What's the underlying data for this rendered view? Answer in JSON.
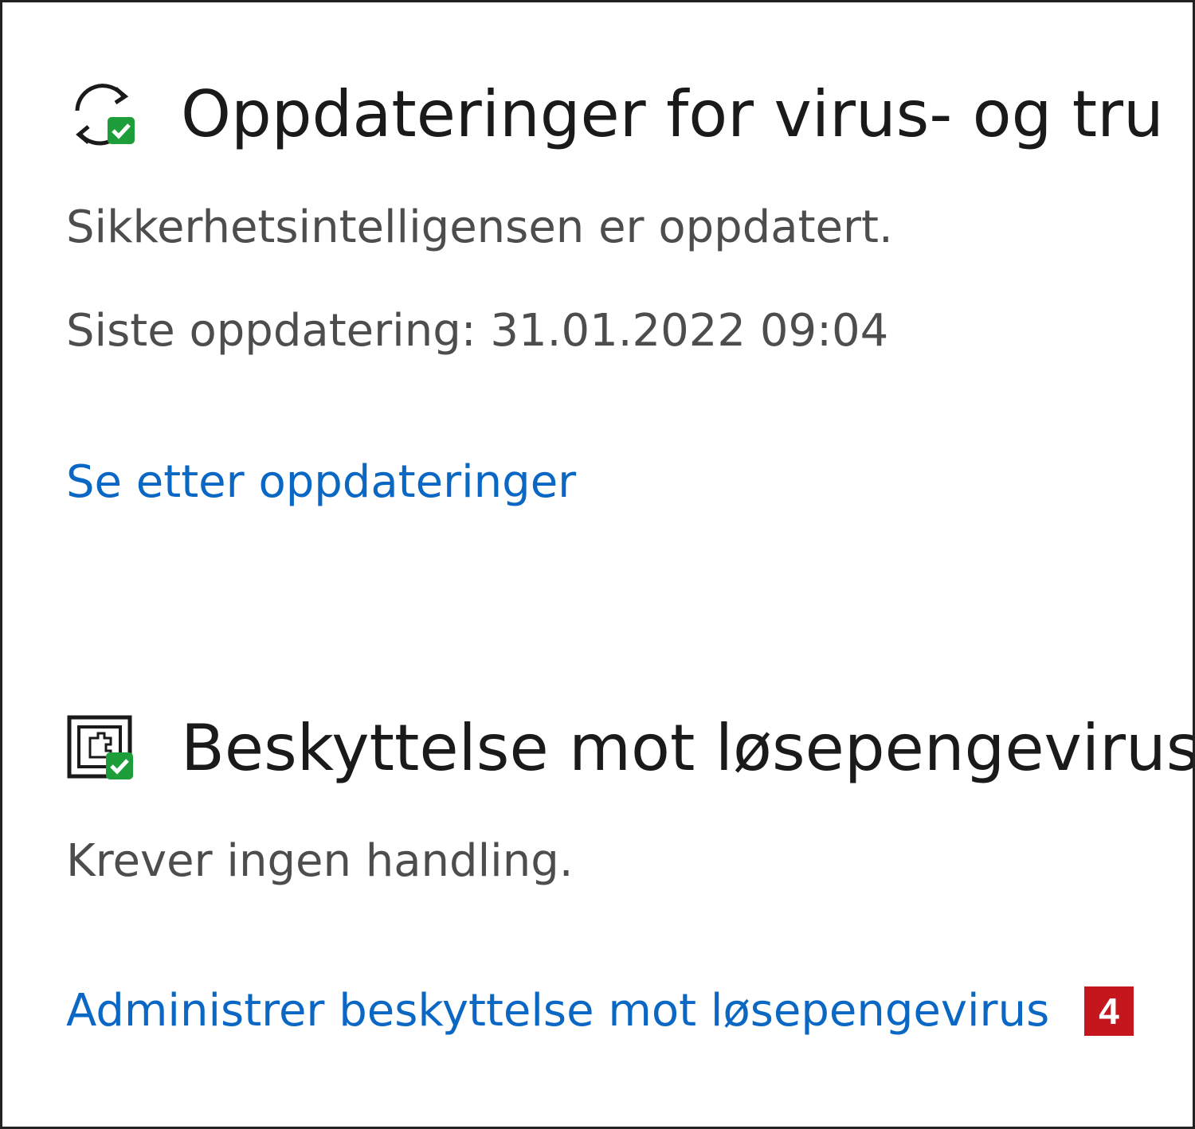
{
  "updates_section": {
    "title": "Oppdateringer for virus- og tru",
    "status": "Sikkerhetsintelligensen er oppdatert.",
    "last_update": "Siste oppdatering: 31.01.2022 09:04",
    "check_link": "Se etter oppdateringer",
    "icon": "refresh-check-icon"
  },
  "ransomware_section": {
    "title": "Beskyttelse mot løsepengevirus",
    "status": "Krever ingen handling.",
    "manage_link": "Administrer beskyttelse mot løsepengevirus",
    "icon": "ransomware-folder-icon",
    "badge": "4"
  },
  "colors": {
    "link": "#0a68c4",
    "status_ok": "#1e9e3a",
    "badge": "#c4161c"
  }
}
